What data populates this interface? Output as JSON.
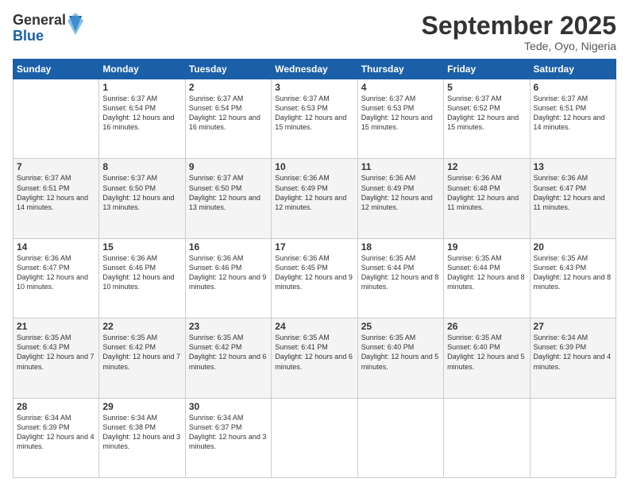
{
  "logo": {
    "general": "General",
    "blue": "Blue"
  },
  "header": {
    "month_year": "September 2025",
    "location": "Tede, Oyo, Nigeria"
  },
  "days_of_week": [
    "Sunday",
    "Monday",
    "Tuesday",
    "Wednesday",
    "Thursday",
    "Friday",
    "Saturday"
  ],
  "weeks": [
    [
      {
        "day": "",
        "info": ""
      },
      {
        "day": "1",
        "info": "Sunrise: 6:37 AM\nSunset: 6:54 PM\nDaylight: 12 hours\nand 16 minutes."
      },
      {
        "day": "2",
        "info": "Sunrise: 6:37 AM\nSunset: 6:54 PM\nDaylight: 12 hours\nand 16 minutes."
      },
      {
        "day": "3",
        "info": "Sunrise: 6:37 AM\nSunset: 6:53 PM\nDaylight: 12 hours\nand 15 minutes."
      },
      {
        "day": "4",
        "info": "Sunrise: 6:37 AM\nSunset: 6:53 PM\nDaylight: 12 hours\nand 15 minutes."
      },
      {
        "day": "5",
        "info": "Sunrise: 6:37 AM\nSunset: 6:52 PM\nDaylight: 12 hours\nand 15 minutes."
      },
      {
        "day": "6",
        "info": "Sunrise: 6:37 AM\nSunset: 6:51 PM\nDaylight: 12 hours\nand 14 minutes."
      }
    ],
    [
      {
        "day": "7",
        "info": "Sunrise: 6:37 AM\nSunset: 6:51 PM\nDaylight: 12 hours\nand 14 minutes."
      },
      {
        "day": "8",
        "info": "Sunrise: 6:37 AM\nSunset: 6:50 PM\nDaylight: 12 hours\nand 13 minutes."
      },
      {
        "day": "9",
        "info": "Sunrise: 6:37 AM\nSunset: 6:50 PM\nDaylight: 12 hours\nand 13 minutes."
      },
      {
        "day": "10",
        "info": "Sunrise: 6:36 AM\nSunset: 6:49 PM\nDaylight: 12 hours\nand 12 minutes."
      },
      {
        "day": "11",
        "info": "Sunrise: 6:36 AM\nSunset: 6:49 PM\nDaylight: 12 hours\nand 12 minutes."
      },
      {
        "day": "12",
        "info": "Sunrise: 6:36 AM\nSunset: 6:48 PM\nDaylight: 12 hours\nand 11 minutes."
      },
      {
        "day": "13",
        "info": "Sunrise: 6:36 AM\nSunset: 6:47 PM\nDaylight: 12 hours\nand 11 minutes."
      }
    ],
    [
      {
        "day": "14",
        "info": "Sunrise: 6:36 AM\nSunset: 6:47 PM\nDaylight: 12 hours\nand 10 minutes."
      },
      {
        "day": "15",
        "info": "Sunrise: 6:36 AM\nSunset: 6:46 PM\nDaylight: 12 hours\nand 10 minutes."
      },
      {
        "day": "16",
        "info": "Sunrise: 6:36 AM\nSunset: 6:46 PM\nDaylight: 12 hours\nand 9 minutes."
      },
      {
        "day": "17",
        "info": "Sunrise: 6:36 AM\nSunset: 6:45 PM\nDaylight: 12 hours\nand 9 minutes."
      },
      {
        "day": "18",
        "info": "Sunrise: 6:35 AM\nSunset: 6:44 PM\nDaylight: 12 hours\nand 8 minutes."
      },
      {
        "day": "19",
        "info": "Sunrise: 6:35 AM\nSunset: 6:44 PM\nDaylight: 12 hours\nand 8 minutes."
      },
      {
        "day": "20",
        "info": "Sunrise: 6:35 AM\nSunset: 6:43 PM\nDaylight: 12 hours\nand 8 minutes."
      }
    ],
    [
      {
        "day": "21",
        "info": "Sunrise: 6:35 AM\nSunset: 6:43 PM\nDaylight: 12 hours\nand 7 minutes."
      },
      {
        "day": "22",
        "info": "Sunrise: 6:35 AM\nSunset: 6:42 PM\nDaylight: 12 hours\nand 7 minutes."
      },
      {
        "day": "23",
        "info": "Sunrise: 6:35 AM\nSunset: 6:42 PM\nDaylight: 12 hours\nand 6 minutes."
      },
      {
        "day": "24",
        "info": "Sunrise: 6:35 AM\nSunset: 6:41 PM\nDaylight: 12 hours\nand 6 minutes."
      },
      {
        "day": "25",
        "info": "Sunrise: 6:35 AM\nSunset: 6:40 PM\nDaylight: 12 hours\nand 5 minutes."
      },
      {
        "day": "26",
        "info": "Sunrise: 6:35 AM\nSunset: 6:40 PM\nDaylight: 12 hours\nand 5 minutes."
      },
      {
        "day": "27",
        "info": "Sunrise: 6:34 AM\nSunset: 6:39 PM\nDaylight: 12 hours\nand 4 minutes."
      }
    ],
    [
      {
        "day": "28",
        "info": "Sunrise: 6:34 AM\nSunset: 6:39 PM\nDaylight: 12 hours\nand 4 minutes."
      },
      {
        "day": "29",
        "info": "Sunrise: 6:34 AM\nSunset: 6:38 PM\nDaylight: 12 hours\nand 3 minutes."
      },
      {
        "day": "30",
        "info": "Sunrise: 6:34 AM\nSunset: 6:37 PM\nDaylight: 12 hours\nand 3 minutes."
      },
      {
        "day": "",
        "info": ""
      },
      {
        "day": "",
        "info": ""
      },
      {
        "day": "",
        "info": ""
      },
      {
        "day": "",
        "info": ""
      }
    ]
  ]
}
